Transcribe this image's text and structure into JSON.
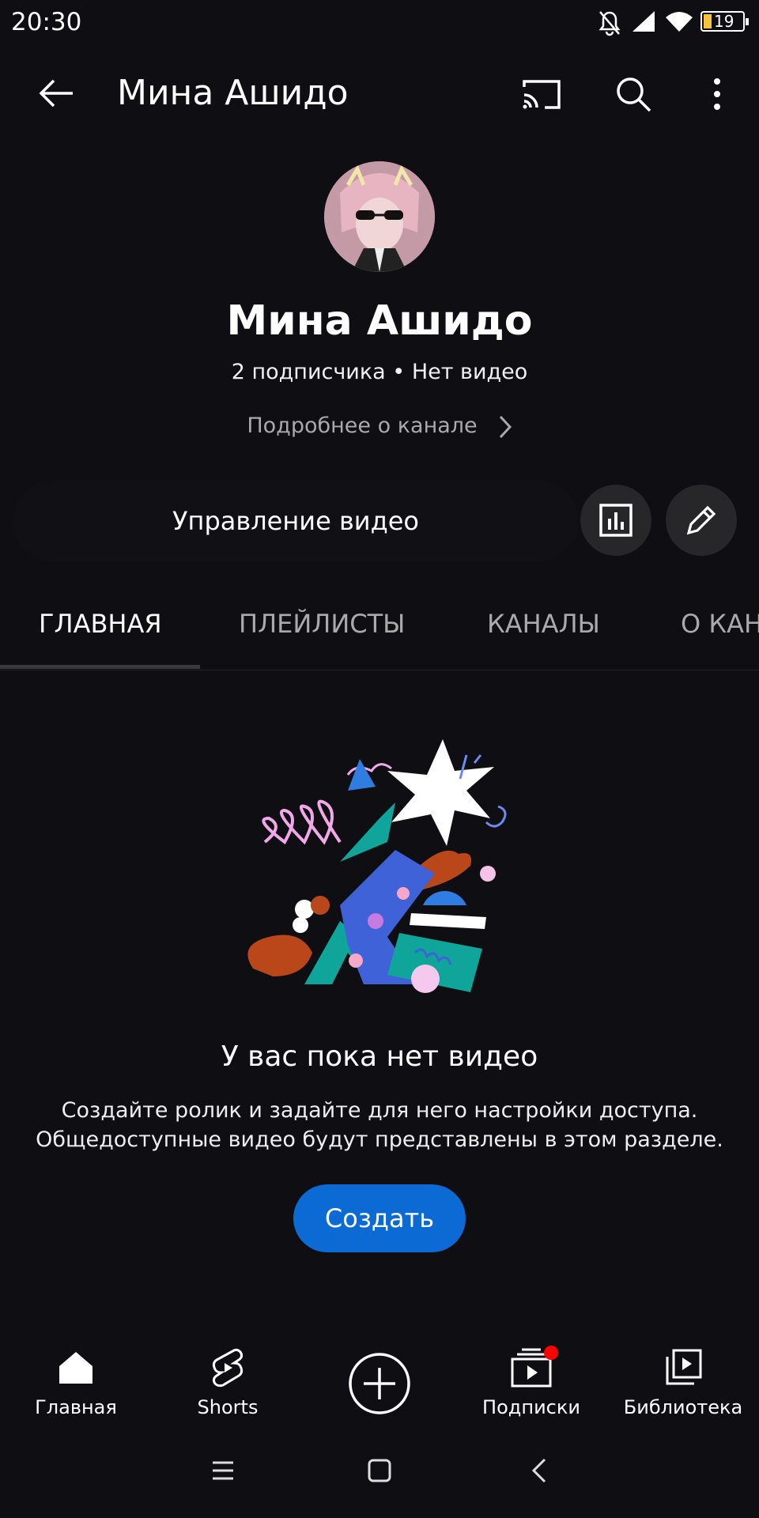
{
  "status_bar": {
    "time": "20:30",
    "battery": "19"
  },
  "header": {
    "title": "Мина Ашидо"
  },
  "channel": {
    "name": "Мина Ашидо",
    "subscribers": "2 подписчика",
    "separator": "•",
    "videos": "Нет видео",
    "more_about": "Подробнее о канале",
    "manage_videos": "Управление видео"
  },
  "tabs": [
    {
      "label": "ГЛАВНАЯ",
      "active": true
    },
    {
      "label": "ПЛЕЙЛИСТЫ",
      "active": false
    },
    {
      "label": "КАНАЛЫ",
      "active": false
    },
    {
      "label": "О КАН",
      "active": false
    }
  ],
  "empty_state": {
    "title": "У вас пока нет видео",
    "description_line1": "Создайте ролик и задайте для него настройки доступа.",
    "description_line2": "Общедоступные видео будут представлены в этом разделе.",
    "button": "Создать"
  },
  "bottom_nav": [
    {
      "label": "Главная",
      "icon": "home-icon"
    },
    {
      "label": "Shorts",
      "icon": "shorts-icon"
    },
    {
      "label": "",
      "icon": "create-plus-icon"
    },
    {
      "label": "Подписки",
      "icon": "subscriptions-icon"
    },
    {
      "label": "Библиотека",
      "icon": "library-icon"
    }
  ],
  "colors": {
    "accent": "#0b6ad3",
    "background": "#0f0e12",
    "notification": "#ff0000"
  }
}
